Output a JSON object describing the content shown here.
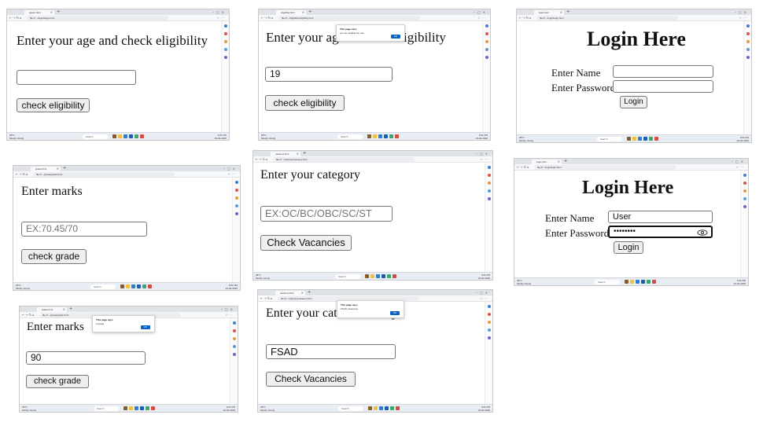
{
  "colors": {
    "taskbar": "#e8ecf3",
    "dialog_ok": "#0b62c4",
    "button_bg": "#efefef",
    "input_border": "#767676"
  },
  "shots": {
    "age_empty": {
      "tab_title": "agech.html",
      "url": "file:///.../agech/age.html",
      "heading": "Enter your age and check eligibility",
      "input_value": "",
      "button": "check eligibility"
    },
    "age_filled": {
      "tab_title": "eligibility.html",
      "url": "file:///.../eligibility/eligibility.html",
      "heading": "Enter your age",
      "heading_tail": "igibility",
      "input_value": "19",
      "button": "check eligibility",
      "dialog_title": "This page says",
      "dialog_message": "you are eligible for vote",
      "dialog_ok": "OK"
    },
    "login_empty": {
      "tab_title": "login.html",
      "url": "file:///.../login/login.html",
      "heading": "Login Here",
      "name_label": "Enter Name",
      "password_label": "Enter Password",
      "button": "Login"
    },
    "login_filled": {
      "tab_title": "login.html",
      "url": "file:///.../login/login.html",
      "heading": "Login Here",
      "name_label": "Enter Name",
      "name_value": "User",
      "password_label": "Enter Password",
      "password_value": "••••••••",
      "button": "Login"
    },
    "marks_empty": {
      "tab_title": "grade.html",
      "url": "file:///.../grade/grade.html",
      "heading": "Enter marks",
      "placeholder": "EX:70.45/70",
      "button": "check grade"
    },
    "marks_filled": {
      "tab_title": "grade.html",
      "url": "file:///.../grade/grade.html",
      "heading": "Enter marks",
      "input_value": "90",
      "button": "check grade",
      "dialog_title": "This page says",
      "dialog_message": "A grade",
      "dialog_ok": "OK"
    },
    "category_empty": {
      "tab_title": "vacancy.html",
      "url": "file:///.../vacancy/vacancy.html",
      "heading": "Enter your category",
      "placeholder": "EX:OC/BC/OBC/SC/ST",
      "button": "Check Vacancies"
    },
    "category_filled": {
      "tab_title": "vacancy.html",
      "url": "file:///.../vacancy/vacancy.html",
      "heading": "Enter your cate",
      "heading_tail": "y",
      "input_value": "FSAD",
      "button": "Check Vacancies",
      "dialog_title": "This page says",
      "dialog_message": "FSAD vacancies",
      "dialog_ok": "OK"
    }
  },
  "taskbar": {
    "weather_temp": "28°C",
    "weather_text": "Mostly cloudy",
    "search": "Search",
    "time": "9:21 PM",
    "date": "23-02-2025"
  }
}
